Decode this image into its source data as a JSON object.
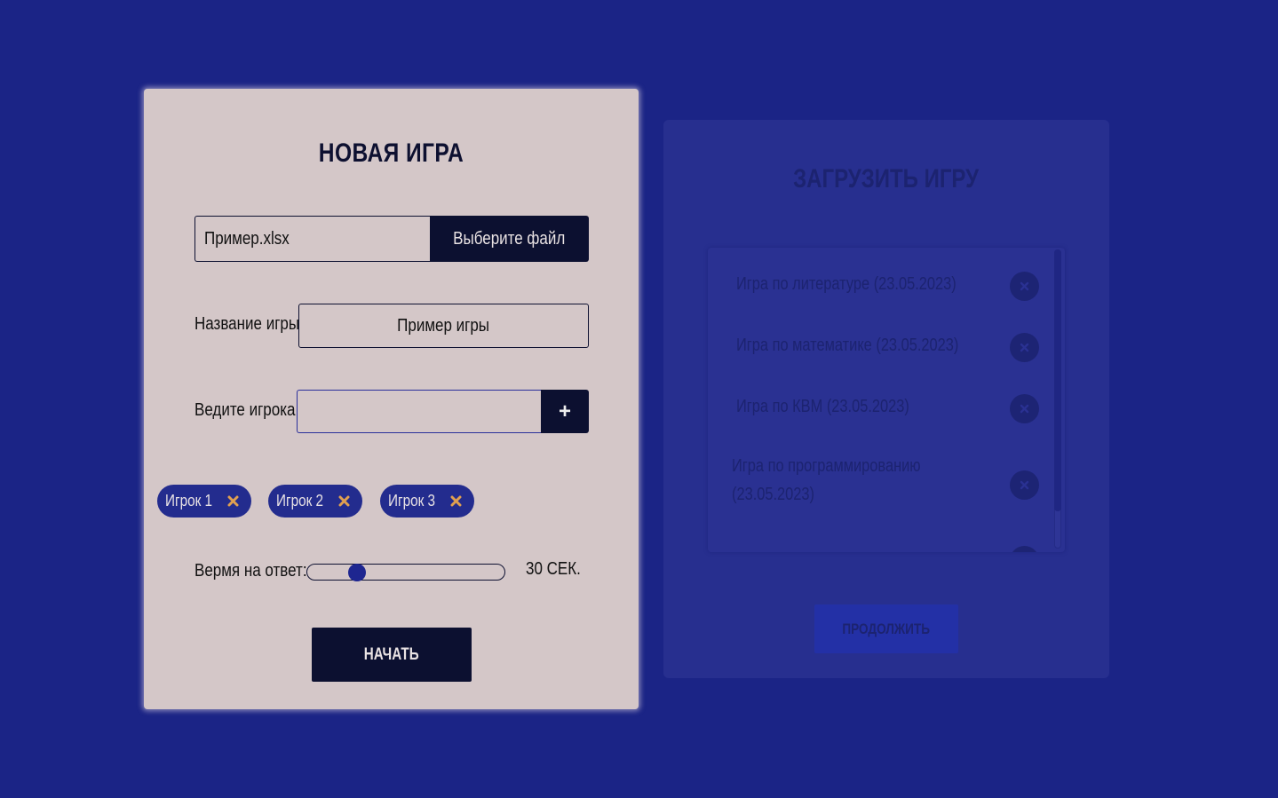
{
  "new_game": {
    "title": "НОВАЯ ИГРА",
    "file": {
      "name": "Пример.xlsx",
      "button_label": "Выберите файл"
    },
    "game_name": {
      "label": "Название игры",
      "value": "Пример игры"
    },
    "player": {
      "label": "Ведите игрока",
      "value": "",
      "add_icon": "plus-icon",
      "add_label": "+"
    },
    "players": [
      {
        "label": "Игрок 1",
        "remove_icon": "close-icon"
      },
      {
        "label": "Игрок 2",
        "remove_icon": "close-icon"
      },
      {
        "label": "Игрок 3",
        "remove_icon": "close-icon"
      }
    ],
    "answer_time": {
      "label": "Вермя на ответ:",
      "value_text": "30 СЕК.",
      "slider_fraction": 0.25
    },
    "start_label": "НАЧАТЬ"
  },
  "load_game": {
    "title": "ЗАГРУЗИТЬ ИГРУ",
    "games": [
      {
        "label": "Игра по литературе (23.05.2023)"
      },
      {
        "label": "Игра по математике (23.05.2023)"
      },
      {
        "label": "Игра по КВМ (23.05.2023)"
      },
      {
        "label": "Игра по программированию (23.05.2023)"
      }
    ],
    "continue_label": "ПРОДОЛЖИТЬ"
  },
  "colors": {
    "background": "#1b2486",
    "panel": "#d4c7c8",
    "dark_button": "#0c1030",
    "chip": "#232c8e",
    "chip_remove": "#e0a050",
    "slider_thumb": "#1e2690"
  }
}
